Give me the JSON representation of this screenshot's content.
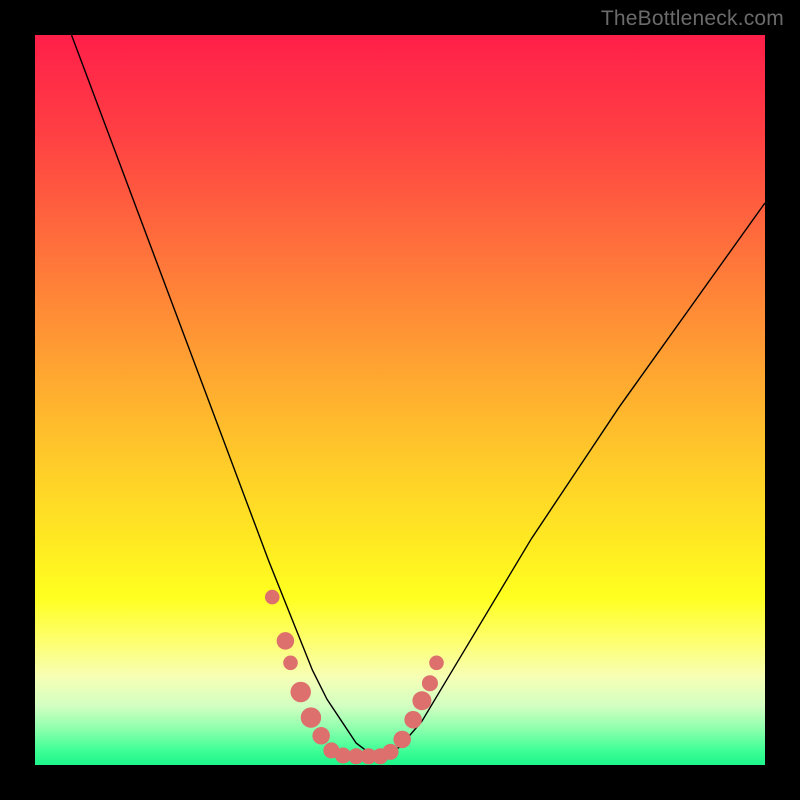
{
  "watermark": "TheBottleneck.com",
  "chart_data": {
    "type": "line",
    "title": "",
    "xlabel": "",
    "ylabel": "",
    "xlim": [
      0,
      100
    ],
    "ylim": [
      0,
      100
    ],
    "grid": false,
    "series": [
      {
        "name": "curve",
        "x": [
          5,
          8,
          11,
          14,
          17,
          20,
          23,
          26,
          29,
          32,
          34,
          36,
          38,
          40,
          42,
          44,
          46,
          48,
          50,
          53,
          56,
          59,
          62,
          65,
          68,
          72,
          76,
          80,
          85,
          90,
          95,
          100
        ],
        "y": [
          100,
          92,
          84,
          76,
          68,
          60,
          52,
          44,
          36,
          28,
          23,
          18,
          13,
          9,
          6,
          3,
          1.5,
          1.2,
          2.5,
          6,
          11,
          16,
          21,
          26,
          31,
          37,
          43,
          49,
          56,
          63,
          70,
          77
        ]
      }
    ],
    "markers": [
      {
        "x": 32.5,
        "y": 23,
        "r": 1.0
      },
      {
        "x": 34.3,
        "y": 17,
        "r": 1.2
      },
      {
        "x": 35.0,
        "y": 14,
        "r": 1.0
      },
      {
        "x": 36.4,
        "y": 10,
        "r": 1.4
      },
      {
        "x": 37.8,
        "y": 6.5,
        "r": 1.4
      },
      {
        "x": 39.2,
        "y": 4.0,
        "r": 1.2
      },
      {
        "x": 40.6,
        "y": 2.0,
        "r": 1.1
      },
      {
        "x": 42.2,
        "y": 1.3,
        "r": 1.1
      },
      {
        "x": 44.0,
        "y": 1.2,
        "r": 1.1
      },
      {
        "x": 45.7,
        "y": 1.2,
        "r": 1.1
      },
      {
        "x": 47.3,
        "y": 1.2,
        "r": 1.1
      },
      {
        "x": 48.7,
        "y": 1.8,
        "r": 1.1
      },
      {
        "x": 50.3,
        "y": 3.5,
        "r": 1.2
      },
      {
        "x": 51.8,
        "y": 6.2,
        "r": 1.2
      },
      {
        "x": 53.0,
        "y": 8.8,
        "r": 1.3
      },
      {
        "x": 54.1,
        "y": 11.2,
        "r": 1.1
      },
      {
        "x": 55.0,
        "y": 14,
        "r": 1.0
      }
    ],
    "colors": {
      "marker_fill": "#dd6f6d",
      "curve_stroke": "#000000"
    }
  }
}
